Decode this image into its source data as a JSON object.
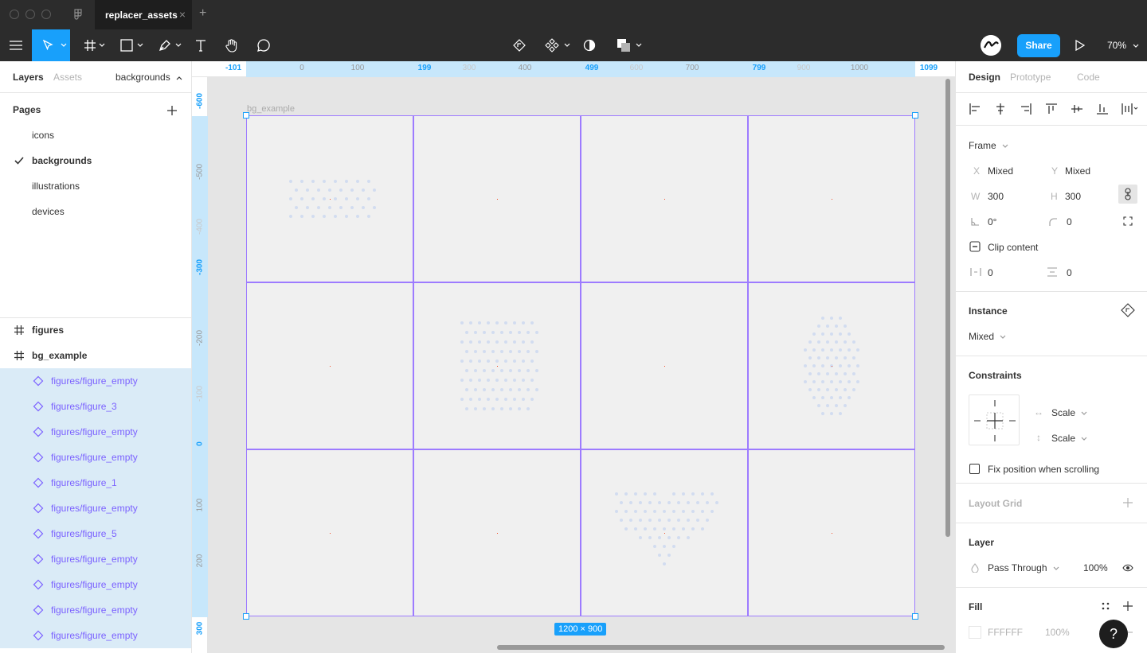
{
  "window": {
    "tab_title": "replacer_assets",
    "tab_close": "×",
    "new_tab": "+"
  },
  "toolbar": {
    "share_label": "Share",
    "zoom_label": "70%"
  },
  "left_panel": {
    "tabs": [
      "Layers",
      "Assets"
    ],
    "page_selector": "backgrounds",
    "pages_header": "Pages",
    "pages": [
      {
        "label": "icons",
        "selected": false
      },
      {
        "label": "backgrounds",
        "selected": true
      },
      {
        "label": "illustrations",
        "selected": false
      },
      {
        "label": "devices",
        "selected": false
      }
    ],
    "layers": [
      {
        "label": "figures",
        "type": "frame",
        "selected": false
      },
      {
        "label": "bg_example",
        "type": "frame",
        "selected": false
      },
      {
        "label": "figures/figure_empty",
        "type": "component",
        "selected": true
      },
      {
        "label": "figures/figure_3",
        "type": "component",
        "selected": true
      },
      {
        "label": "figures/figure_empty",
        "type": "component",
        "selected": true
      },
      {
        "label": "figures/figure_empty",
        "type": "component",
        "selected": true
      },
      {
        "label": "figures/figure_1",
        "type": "component",
        "selected": true
      },
      {
        "label": "figures/figure_empty",
        "type": "component",
        "selected": true
      },
      {
        "label": "figures/figure_5",
        "type": "component",
        "selected": true
      },
      {
        "label": "figures/figure_empty",
        "type": "component",
        "selected": true
      },
      {
        "label": "figures/figure_empty",
        "type": "component",
        "selected": true
      },
      {
        "label": "figures/figure_empty",
        "type": "component",
        "selected": true
      },
      {
        "label": "figures/figure_empty",
        "type": "component",
        "selected": true
      }
    ]
  },
  "canvas": {
    "frame_name": "bg_example",
    "size_badge": "1200 × 900",
    "h_ruler": [
      {
        "text": "-101",
        "style": "b"
      },
      {
        "text": "0",
        "style": "n"
      },
      {
        "text": "100",
        "style": "n"
      },
      {
        "text": "199",
        "style": "b"
      },
      {
        "text": "300",
        "style": "f"
      },
      {
        "text": "400",
        "style": "n"
      },
      {
        "text": "499",
        "style": "b"
      },
      {
        "text": "600",
        "style": "f"
      },
      {
        "text": "700",
        "style": "n"
      },
      {
        "text": "799",
        "style": "b"
      },
      {
        "text": "900",
        "style": "f"
      },
      {
        "text": "1000",
        "style": "n"
      },
      {
        "text": "1099",
        "style": "b"
      }
    ],
    "v_ruler": [
      {
        "text": "-600",
        "style": "b"
      },
      {
        "text": "-500",
        "style": "n"
      },
      {
        "text": "-400",
        "style": "f"
      },
      {
        "text": "-300",
        "style": "b"
      },
      {
        "text": "-200",
        "style": "n"
      },
      {
        "text": "-100",
        "style": "f"
      },
      {
        "text": "0",
        "style": "b"
      },
      {
        "text": "100",
        "style": "n"
      },
      {
        "text": "200",
        "style": "n"
      },
      {
        "text": "300",
        "style": "b"
      }
    ],
    "cells": [
      "figure_empty",
      "figure_empty",
      "figure_empty",
      "figure_empty",
      "figure_empty",
      "figure_3",
      "figure_empty",
      "figure_1",
      "figure_empty",
      "figure_empty",
      "figure_5",
      "figure_empty"
    ],
    "colors": {
      "frame_stroke": "#9d7bff",
      "selection": "#18a0fb",
      "dots": "#d2dcf0",
      "center_mark": "#f24822"
    }
  },
  "right_panel": {
    "tabs": [
      "Design",
      "Prototype",
      "Code"
    ],
    "frame_label": "Frame",
    "x_label": "X",
    "x_value": "Mixed",
    "y_label": "Y",
    "y_value": "Mixed",
    "w_label": "W",
    "w_value": "300",
    "h_label": "H",
    "h_value": "300",
    "rotation_value": "0°",
    "radius_value": "0",
    "clip_content": "Clip content",
    "spacing_h": "0",
    "spacing_v": "0",
    "instance_header": "Instance",
    "instance_value": "Mixed",
    "constraints_header": "Constraints",
    "constraint_h": "Scale",
    "constraint_v": "Scale",
    "fix_position": "Fix position when scrolling",
    "layout_grid_header": "Layout Grid",
    "layer_header": "Layer",
    "blend_mode": "Pass Through",
    "layer_opacity": "100%",
    "fill_header": "Fill",
    "fill_hex": "FFFFFF",
    "fill_opacity": "100%",
    "help": "?"
  }
}
